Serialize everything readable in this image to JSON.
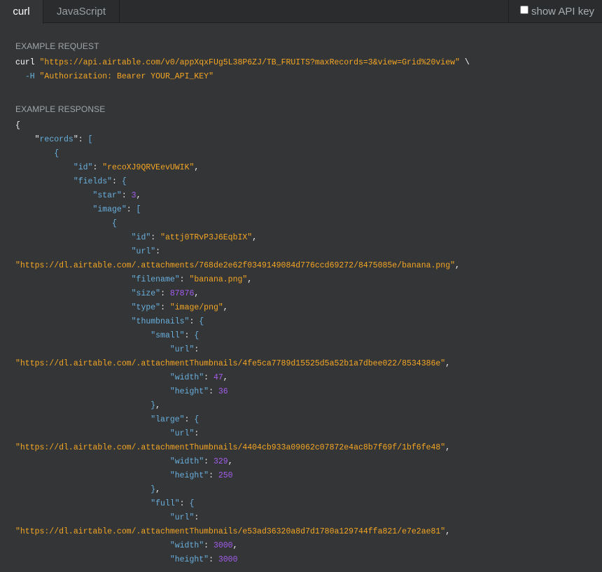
{
  "tabs": [
    {
      "label": "curl",
      "active": true
    },
    {
      "label": "JavaScript",
      "active": false
    }
  ],
  "api_key_toggle": {
    "label": "show API key",
    "checked": false
  },
  "request": {
    "heading": "EXAMPLE REQUEST",
    "lines": [
      [
        {
          "t": "w",
          "v": "curl "
        },
        {
          "t": "s",
          "v": "\"https://api.airtable.com/v0/appXqxFUg5L38P6ZJ/TB_FRUITS?maxRecords=3&view=Grid%20view\""
        },
        {
          "t": "w",
          "v": " \\"
        }
      ],
      [
        {
          "t": "w",
          "v": "  "
        },
        {
          "t": "f",
          "v": "-H"
        },
        {
          "t": "w",
          "v": " "
        },
        {
          "t": "s",
          "v": "\"Authorization: Bearer YOUR_API_KEY\""
        }
      ]
    ]
  },
  "response": {
    "heading": "EXAMPLE RESPONSE",
    "lines": [
      [
        {
          "t": "p",
          "v": "{"
        }
      ],
      [
        {
          "t": "p",
          "v": "    \""
        },
        {
          "t": "k",
          "v": "records"
        },
        {
          "t": "p",
          "v": "\": "
        },
        {
          "t": "k",
          "v": "["
        }
      ],
      [
        {
          "t": "p",
          "v": "        "
        },
        {
          "t": "k",
          "v": "{"
        }
      ],
      [
        {
          "t": "p",
          "v": "            "
        },
        {
          "t": "k",
          "v": "\"id\""
        },
        {
          "t": "p",
          "v": ": "
        },
        {
          "t": "s",
          "v": "\"recoXJ9QRVEevUWIK\""
        },
        {
          "t": "p",
          "v": ","
        }
      ],
      [
        {
          "t": "p",
          "v": "            "
        },
        {
          "t": "k",
          "v": "\"fields\""
        },
        {
          "t": "p",
          "v": ": "
        },
        {
          "t": "k",
          "v": "{"
        }
      ],
      [
        {
          "t": "p",
          "v": "                "
        },
        {
          "t": "k",
          "v": "\"star\""
        },
        {
          "t": "p",
          "v": ": "
        },
        {
          "t": "n",
          "v": "3"
        },
        {
          "t": "p",
          "v": ","
        }
      ],
      [
        {
          "t": "p",
          "v": "                "
        },
        {
          "t": "k",
          "v": "\"image\""
        },
        {
          "t": "p",
          "v": ": "
        },
        {
          "t": "k",
          "v": "["
        }
      ],
      [
        {
          "t": "p",
          "v": "                    "
        },
        {
          "t": "k",
          "v": "{"
        }
      ],
      [
        {
          "t": "p",
          "v": "                        "
        },
        {
          "t": "k",
          "v": "\"id\""
        },
        {
          "t": "p",
          "v": ": "
        },
        {
          "t": "s",
          "v": "\"attj0TRvP3J6EqbIX\""
        },
        {
          "t": "p",
          "v": ","
        }
      ],
      [
        {
          "t": "p",
          "v": "                        "
        },
        {
          "t": "k",
          "v": "\"url\""
        },
        {
          "t": "p",
          "v": ":"
        }
      ],
      [
        {
          "t": "s",
          "v": "\"https://dl.airtable.com/.attachments/768de2e62f0349149084d776ccd69272/8475085e/banana.png\""
        },
        {
          "t": "p",
          "v": ","
        }
      ],
      [
        {
          "t": "p",
          "v": "                        "
        },
        {
          "t": "k",
          "v": "\"filename\""
        },
        {
          "t": "p",
          "v": ": "
        },
        {
          "t": "s",
          "v": "\"banana.png\""
        },
        {
          "t": "p",
          "v": ","
        }
      ],
      [
        {
          "t": "p",
          "v": "                        "
        },
        {
          "t": "k",
          "v": "\"size\""
        },
        {
          "t": "p",
          "v": ": "
        },
        {
          "t": "n",
          "v": "87876"
        },
        {
          "t": "p",
          "v": ","
        }
      ],
      [
        {
          "t": "p",
          "v": "                        "
        },
        {
          "t": "k",
          "v": "\"type\""
        },
        {
          "t": "p",
          "v": ": "
        },
        {
          "t": "s",
          "v": "\"image/png\""
        },
        {
          "t": "p",
          "v": ","
        }
      ],
      [
        {
          "t": "p",
          "v": "                        "
        },
        {
          "t": "k",
          "v": "\"thumbnails\""
        },
        {
          "t": "p",
          "v": ": "
        },
        {
          "t": "k",
          "v": "{"
        }
      ],
      [
        {
          "t": "p",
          "v": "                            "
        },
        {
          "t": "k",
          "v": "\"small\""
        },
        {
          "t": "p",
          "v": ": "
        },
        {
          "t": "k",
          "v": "{"
        }
      ],
      [
        {
          "t": "p",
          "v": "                                "
        },
        {
          "t": "k",
          "v": "\"url\""
        },
        {
          "t": "p",
          "v": ":"
        }
      ],
      [
        {
          "t": "s",
          "v": "\"https://dl.airtable.com/.attachmentThumbnails/4fe5ca7789d15525d5a52b1a7dbee022/8534386e\""
        },
        {
          "t": "p",
          "v": ","
        }
      ],
      [
        {
          "t": "p",
          "v": "                                "
        },
        {
          "t": "k",
          "v": "\"width\""
        },
        {
          "t": "p",
          "v": ": "
        },
        {
          "t": "n",
          "v": "47"
        },
        {
          "t": "p",
          "v": ","
        }
      ],
      [
        {
          "t": "p",
          "v": "                                "
        },
        {
          "t": "k",
          "v": "\"height\""
        },
        {
          "t": "p",
          "v": ": "
        },
        {
          "t": "n",
          "v": "36"
        }
      ],
      [
        {
          "t": "p",
          "v": "                            "
        },
        {
          "t": "k",
          "v": "}"
        },
        {
          "t": "p",
          "v": ","
        }
      ],
      [
        {
          "t": "p",
          "v": "                            "
        },
        {
          "t": "k",
          "v": "\"large\""
        },
        {
          "t": "p",
          "v": ": "
        },
        {
          "t": "k",
          "v": "{"
        }
      ],
      [
        {
          "t": "p",
          "v": "                                "
        },
        {
          "t": "k",
          "v": "\"url\""
        },
        {
          "t": "p",
          "v": ":"
        }
      ],
      [
        {
          "t": "s",
          "v": "\"https://dl.airtable.com/.attachmentThumbnails/4404cb933a09062c07872e4ac8b7f69f/1bf6fe48\""
        },
        {
          "t": "p",
          "v": ","
        }
      ],
      [
        {
          "t": "p",
          "v": "                                "
        },
        {
          "t": "k",
          "v": "\"width\""
        },
        {
          "t": "p",
          "v": ": "
        },
        {
          "t": "n",
          "v": "329"
        },
        {
          "t": "p",
          "v": ","
        }
      ],
      [
        {
          "t": "p",
          "v": "                                "
        },
        {
          "t": "k",
          "v": "\"height\""
        },
        {
          "t": "p",
          "v": ": "
        },
        {
          "t": "n",
          "v": "250"
        }
      ],
      [
        {
          "t": "p",
          "v": "                            "
        },
        {
          "t": "k",
          "v": "}"
        },
        {
          "t": "p",
          "v": ","
        }
      ],
      [
        {
          "t": "p",
          "v": "                            "
        },
        {
          "t": "k",
          "v": "\"full\""
        },
        {
          "t": "p",
          "v": ": "
        },
        {
          "t": "k",
          "v": "{"
        }
      ],
      [
        {
          "t": "p",
          "v": "                                "
        },
        {
          "t": "k",
          "v": "\"url\""
        },
        {
          "t": "p",
          "v": ":"
        }
      ],
      [
        {
          "t": "s",
          "v": "\"https://dl.airtable.com/.attachmentThumbnails/e53ad36320a8d7d1780a129744ffa821/e7e2ae81\""
        },
        {
          "t": "p",
          "v": ","
        }
      ],
      [
        {
          "t": "p",
          "v": "                                "
        },
        {
          "t": "k",
          "v": "\"width\""
        },
        {
          "t": "p",
          "v": ": "
        },
        {
          "t": "n",
          "v": "3000"
        },
        {
          "t": "p",
          "v": ","
        }
      ],
      [
        {
          "t": "p",
          "v": "                                "
        },
        {
          "t": "k",
          "v": "\"height\""
        },
        {
          "t": "p",
          "v": ": "
        },
        {
          "t": "n",
          "v": "3000"
        }
      ]
    ]
  },
  "colors": {
    "background": "#333537",
    "key": "#6ab0de",
    "string": "#f5a623",
    "number": "#a45ded"
  }
}
